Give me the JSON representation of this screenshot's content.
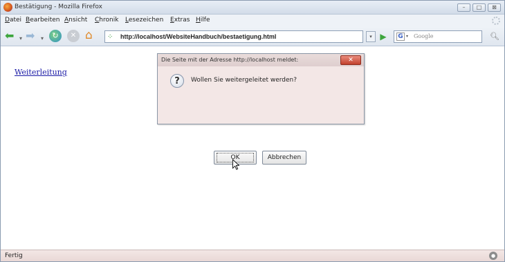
{
  "window": {
    "title": "Bestätigung - Mozilla Firefox",
    "minimize": "–",
    "maximize": "□",
    "close": "⊠"
  },
  "menu": [
    "Datei",
    "Bearbeiten",
    "Ansicht",
    "Chronik",
    "Lesezeichen",
    "Extras",
    "Hilfe"
  ],
  "navbar": {
    "url": "http://localhost/WebsiteHandbuch/bestaetigung.html",
    "search_engine": "Google",
    "search_engine_letter": "G"
  },
  "content": {
    "link_text": "Weiterleitung"
  },
  "dialog": {
    "title": "Die Seite mit der Adresse http://localhost meldet:",
    "message": "Wollen Sie weitergeleitet werden?",
    "ok_label": "OK",
    "cancel_label": "Abbrechen",
    "close_label": "✕"
  },
  "status": {
    "text": "Fertig"
  },
  "colors": {
    "link": "#1a1aa6",
    "dialog_bg": "#f3e7e6",
    "close_red": "#c2412d"
  }
}
